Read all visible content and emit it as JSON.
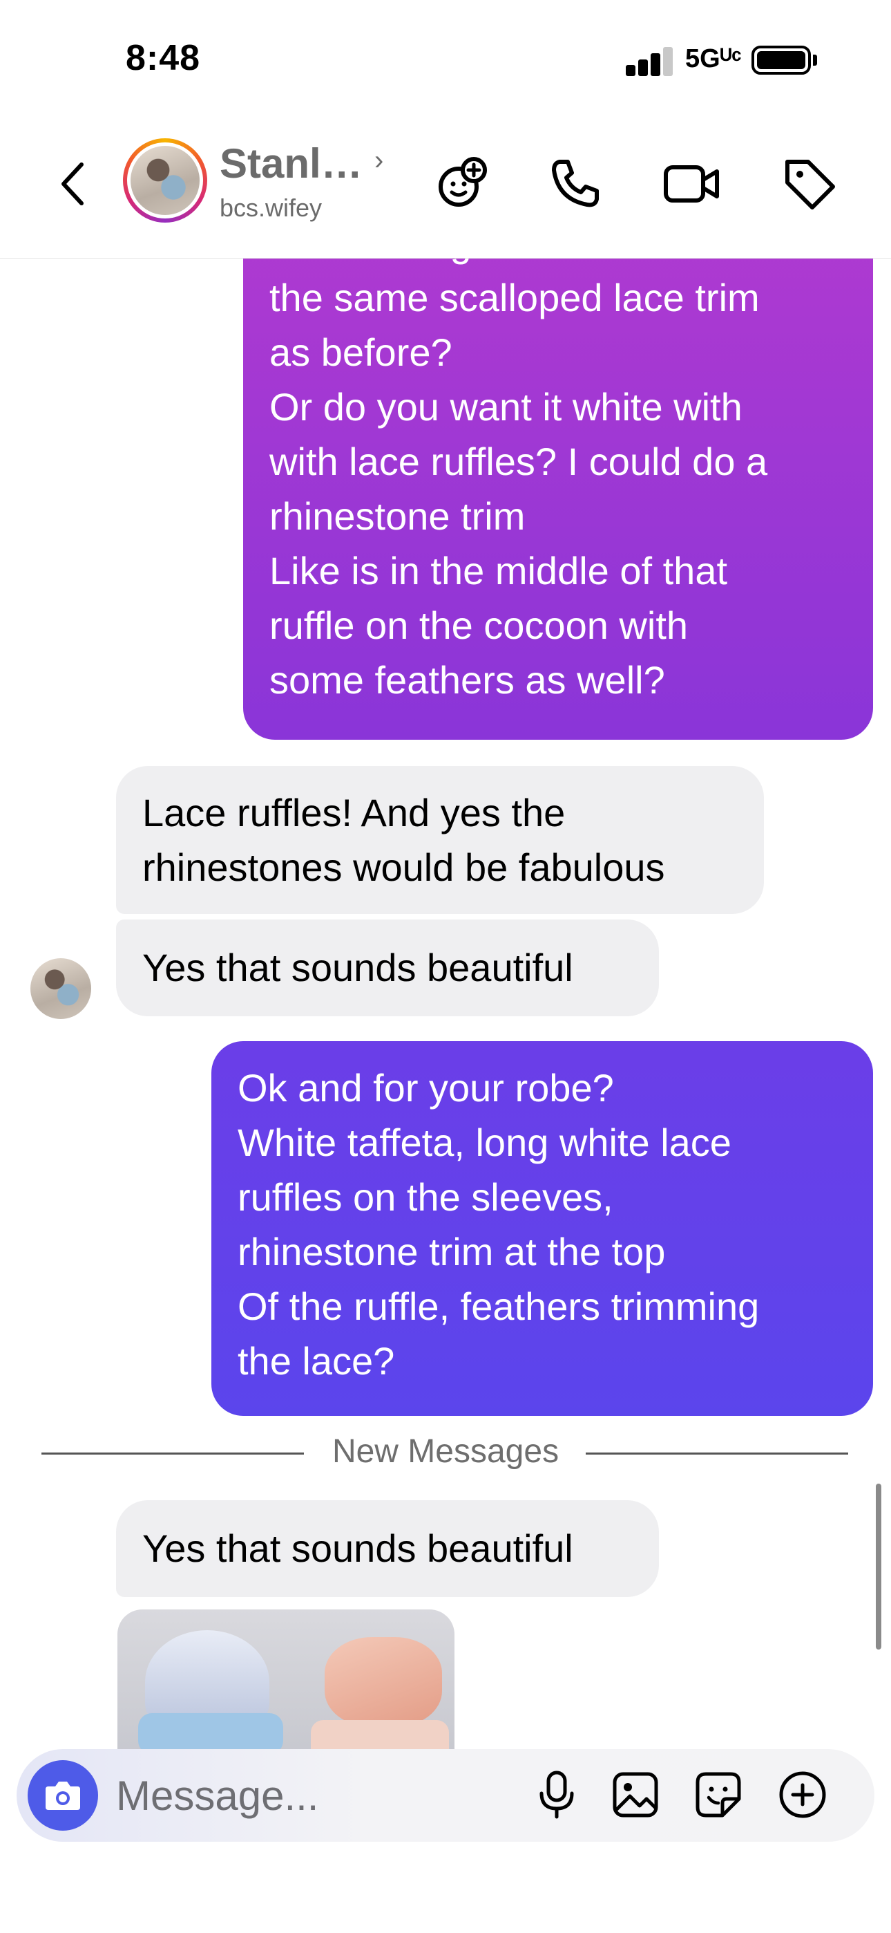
{
  "status_bar": {
    "time": "8:48",
    "network": "5Gᵁᶜ"
  },
  "header": {
    "contact_name": "Stanl…",
    "username": "bcs.wifey",
    "icons": [
      "back-icon",
      "avatar",
      "effects-icon",
      "phone-icon",
      "video-icon",
      "tag-icon"
    ]
  },
  "messages": [
    {
      "side": "sent",
      "lines": [
        "the bedding and robe? With",
        "the same scalloped lace trim",
        "as before?",
        "Or do you want it white with",
        "with lace ruffles? I could do a",
        "rhinestone trim",
        "Like is in the middle of that",
        "ruffle on the cocoon with",
        "some feathers as well?"
      ]
    },
    {
      "side": "received",
      "lines": [
        "Lace ruffles! And yes the",
        "rhinestones would be fabulous"
      ]
    },
    {
      "side": "received",
      "lines": [
        "Yes that sounds beautiful"
      ]
    },
    {
      "side": "sent",
      "lines": [
        "Ok and for your robe?",
        "White taffeta, long white lace",
        "ruffles on the sleeves,",
        "rhinestone trim at the top",
        "Of the ruffle, feathers trimming",
        "the lace?"
      ]
    },
    {
      "side": "received",
      "lines": [
        "Yes that sounds beautiful"
      ]
    }
  ],
  "divider": {
    "label": "New Messages"
  },
  "composer": {
    "placeholder": "Message...",
    "icons": [
      "camera-icon",
      "microphone-icon",
      "gallery-icon",
      "sticker-icon",
      "plus-circle-icon"
    ]
  },
  "colors": {
    "sent_gradient_top": "#b13ad0",
    "sent_gradient_bottom": "#5b45ec",
    "received_bg": "#efeff1",
    "camera_button": "#4e5be8"
  }
}
